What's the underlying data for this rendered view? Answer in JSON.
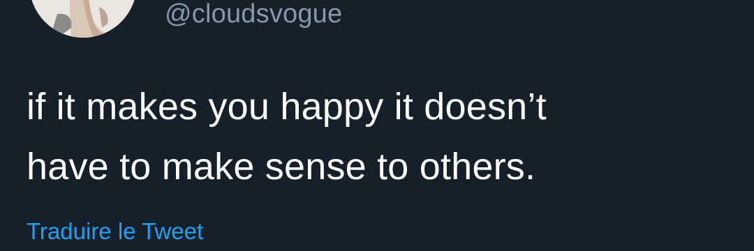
{
  "author": {
    "handle": "@cloudsvogue",
    "avatar_icon": "profile-photo"
  },
  "tweet": {
    "lines": [
      "if it makes you happy it doesn’t",
      "have to make sense to others."
    ]
  },
  "actions": {
    "translate_label": "Traduire le Tweet"
  },
  "colors": {
    "background": "#15202b",
    "text": "#ffffff",
    "secondary_text": "#8899a6",
    "link": "#1da1f2"
  }
}
